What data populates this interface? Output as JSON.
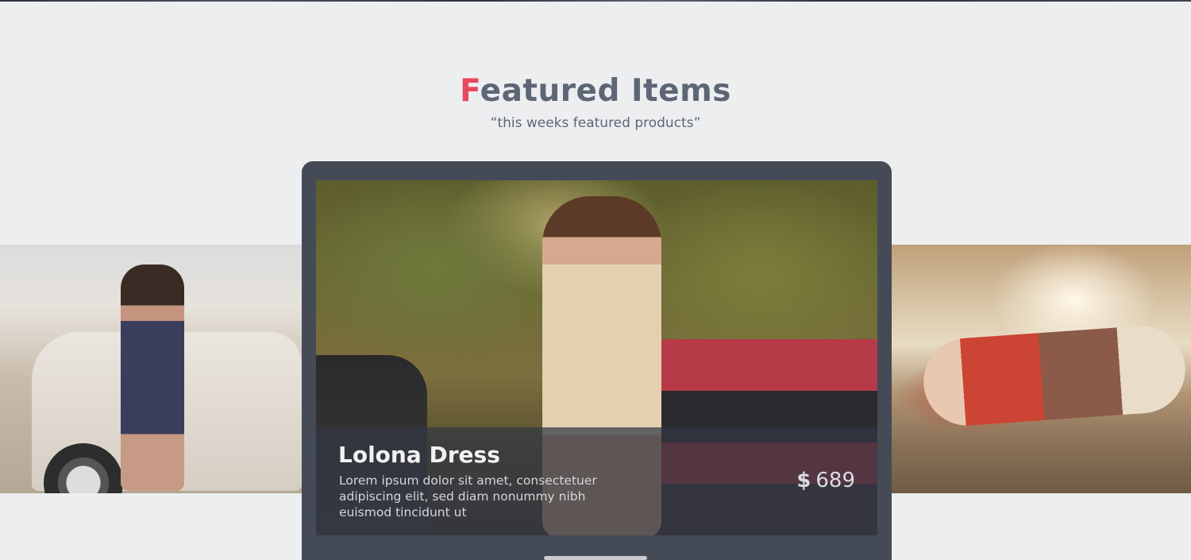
{
  "section": {
    "title_accent": "F",
    "title_rest": "eatured Items",
    "subtitle": "“this weeks featured products”"
  },
  "featured": {
    "name": "Lolona Dress",
    "description": "Lorem ipsum dolor sit amet, consectetuer adipiscing elit, sed diam nonummy nibh euismod tincidunt ut",
    "currency": "$",
    "price": "689"
  },
  "colors": {
    "accent": "#e8475f",
    "text_muted": "#5c6675",
    "monitor_frame": "#444b57",
    "background": "#edeef0"
  }
}
